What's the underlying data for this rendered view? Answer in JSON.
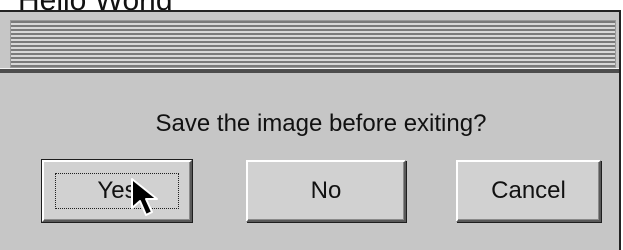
{
  "background": {
    "title": "Hello World"
  },
  "dialog": {
    "message": "Save the image before exiting?",
    "buttons": {
      "yes": "Yes",
      "no": "No",
      "cancel": "Cancel"
    },
    "focused_button": "yes"
  },
  "icons": {
    "cursor": "arrow-cursor-icon"
  },
  "colors": {
    "dialog_bg": "#c6c6c6",
    "text": "#111111"
  }
}
